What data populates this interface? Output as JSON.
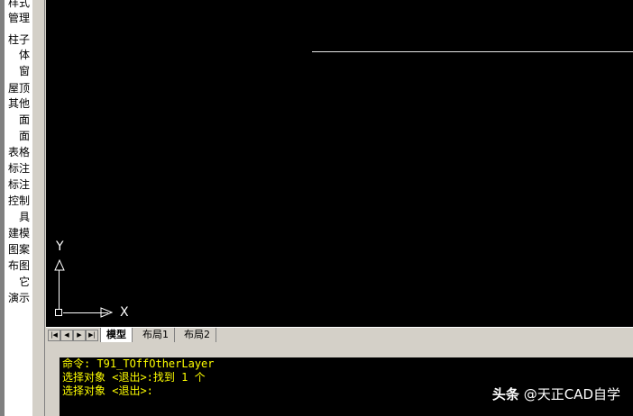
{
  "sidebar": {
    "items": [
      "样式",
      "管理",
      "柱子",
      "体",
      "窗",
      "屋顶",
      "其他",
      "面",
      "面",
      "表格",
      "标注",
      "标注",
      "控制",
      "具",
      "建模",
      "图案",
      "布图",
      "它",
      "演示"
    ]
  },
  "canvas": {
    "ucs_y": "Y",
    "ucs_x": "X"
  },
  "tabs": {
    "nav": [
      "|◀",
      "◀",
      "▶",
      "▶|"
    ],
    "model": "模型",
    "layout1": "布局1",
    "layout2": "布局2"
  },
  "command": {
    "lines": [
      "命令: T91_TOffOtherLayer",
      "选择对象 <退出>:找到 1 个",
      "选择对象 <退出>:"
    ]
  },
  "watermark": {
    "brand": "头条",
    "handle": "@天正CAD自学"
  },
  "colors": {
    "canvas_bg": "#000000",
    "command_text": "#ffff00"
  }
}
